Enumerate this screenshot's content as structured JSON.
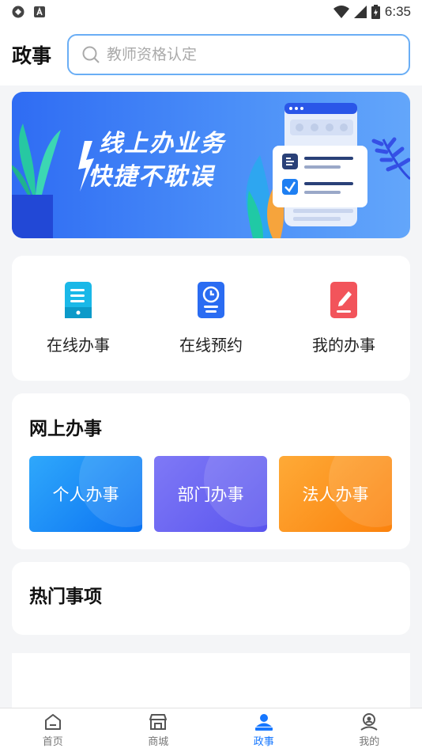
{
  "status_bar": {
    "time": "6:35"
  },
  "header": {
    "title": "政事",
    "search_placeholder": "教师资格认定"
  },
  "banner": {
    "line1": "线上办业务",
    "line2": "快捷不耽误"
  },
  "quick_actions": [
    {
      "label": "在线办事",
      "icon": "tablet-doc-icon",
      "color": "#1ab8e8"
    },
    {
      "label": "在线预约",
      "icon": "clock-doc-icon",
      "color": "#2a6cf2"
    },
    {
      "label": "我的办事",
      "icon": "edit-doc-icon",
      "color": "#f2545b"
    }
  ],
  "online_section": {
    "title": "网上办事",
    "tiles": [
      {
        "label": "个人办事",
        "color": "#1a8ff7"
      },
      {
        "label": "部门办事",
        "color": "#6d66f4"
      },
      {
        "label": "法人办事",
        "color": "#fc8f1f"
      }
    ]
  },
  "hot_section": {
    "title": "热门事项"
  },
  "tabbar": {
    "items": [
      {
        "label": "首页",
        "icon": "home-icon"
      },
      {
        "label": "商城",
        "icon": "store-icon"
      },
      {
        "label": "政事",
        "icon": "government-icon",
        "active": true
      },
      {
        "label": "我的",
        "icon": "profile-icon"
      }
    ]
  },
  "colors": {
    "accent": "#1677ff",
    "search_border": "#6aaef5"
  }
}
